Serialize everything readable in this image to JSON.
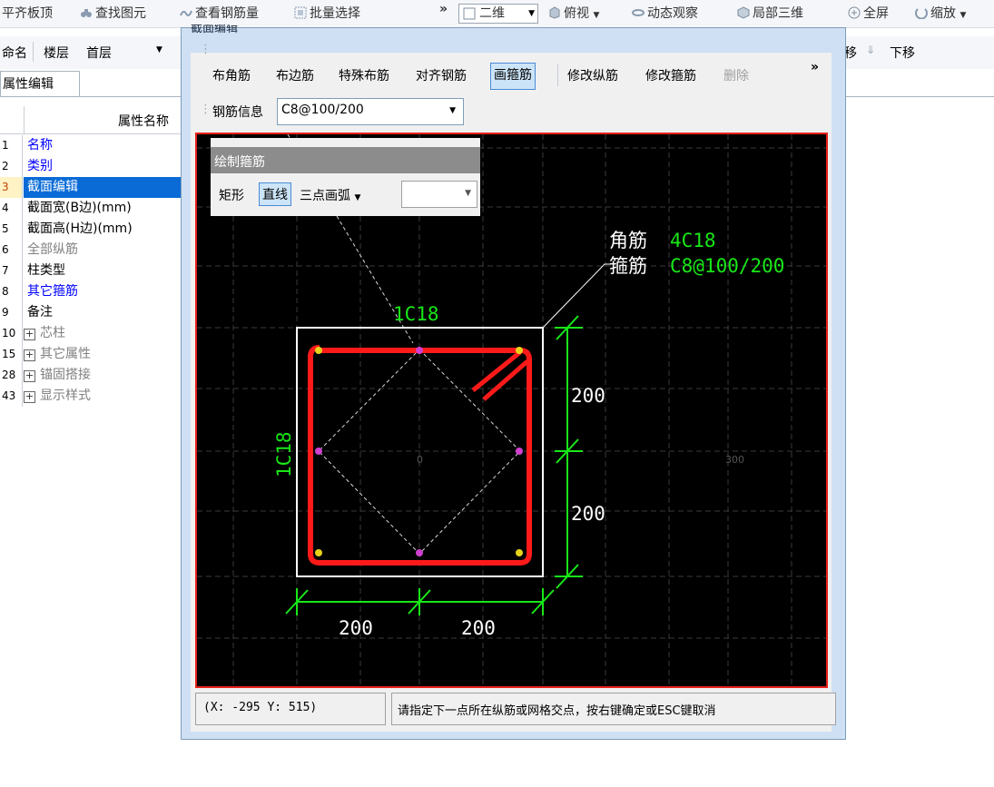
{
  "toolbar": {
    "items": [
      "平齐板顶",
      "查找图元",
      "查看钢筋量",
      "批量选择",
      "»",
      "二维",
      "俯视",
      "动态观察",
      "局部三维",
      "全屏",
      "缩放"
    ]
  },
  "row2": {
    "name_label": "命名",
    "floor_label": "楼层",
    "floor_value": "首层",
    "move_down": "下移",
    "partial": "移"
  },
  "property_panel": {
    "tab": "属性编辑",
    "header": "属性名称",
    "rows": [
      {
        "num": "1",
        "name": "名称",
        "color": "#0000ff"
      },
      {
        "num": "2",
        "name": "类别",
        "color": "#0000ff"
      },
      {
        "num": "3",
        "name": "截面编辑",
        "color": "#ffffff"
      },
      {
        "num": "4",
        "name": "截面宽(B边)(mm)",
        "color": "#000000"
      },
      {
        "num": "5",
        "name": "截面高(H边)(mm)",
        "color": "#000000"
      },
      {
        "num": "6",
        "name": "全部纵筋",
        "color": "#808080"
      },
      {
        "num": "7",
        "name": "柱类型",
        "color": "#000000"
      },
      {
        "num": "8",
        "name": "其它箍筋",
        "color": "#0000ff"
      },
      {
        "num": "9",
        "name": "备注",
        "color": "#000000"
      },
      {
        "num": "10",
        "name": "芯柱",
        "color": "#808080"
      },
      {
        "num": "15",
        "name": "其它属性",
        "color": "#808080"
      },
      {
        "num": "28",
        "name": "锚固搭接",
        "color": "#808080"
      },
      {
        "num": "43",
        "name": "显示样式",
        "color": "#808080"
      }
    ]
  },
  "dialog": {
    "title": "截面编辑",
    "buttons": [
      "布角筋",
      "布边筋",
      "特殊布筋",
      "对齐钢筋",
      "画箍筋",
      "修改纵筋",
      "修改箍筋",
      "删除"
    ],
    "more": "»",
    "rebar_label": "钢筋信息",
    "rebar_value": "C8@100/200"
  },
  "popup": {
    "title": "绘制箍筋",
    "rect": "矩形",
    "line": "直线",
    "arc": "三点画弧"
  },
  "drawing": {
    "corner_label": "角筋",
    "corner_value": "4C18",
    "stirrup_label": "箍筋",
    "stirrup_value": "C8@100/200",
    "top_bar": "1C18",
    "side_bar": "1C18",
    "dim_right_1": "200",
    "dim_right_2": "200",
    "dim_bottom_1": "200",
    "dim_bottom_2": "200",
    "axis_zero": "0",
    "axis_300": "300"
  },
  "status": {
    "coords": "(X: -295 Y: 515)",
    "message": "请指定下一点所在纵筋或网格交点，按右键确定或ESC键取消"
  },
  "colors": {
    "accent": "#0a6bd6",
    "canvas_border": "#e8211a",
    "rebar": "#ff1a1a",
    "dim": "#18e818"
  }
}
